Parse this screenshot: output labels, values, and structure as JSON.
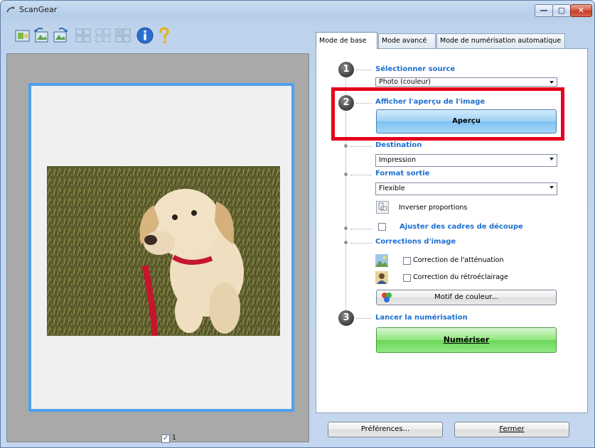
{
  "window": {
    "title": "ScanGear",
    "controls": {
      "minimize": "—",
      "maximize": "▢",
      "close": "✕"
    }
  },
  "toolbar": {
    "icons": [
      "scan-thumbnail-icon",
      "rotate-left-icon",
      "rotate-right-icon",
      "crop-icon",
      "select-all-icon",
      "remove-crop-icon",
      "info-icon",
      "help-icon"
    ]
  },
  "preview": {
    "thumbnail_number": "1",
    "thumbnail_checked": true
  },
  "tabs": [
    {
      "label": "Mode de base",
      "active": true
    },
    {
      "label": "Mode avancé",
      "active": false
    },
    {
      "label": "Mode de numérisation automatique",
      "active": false
    }
  ],
  "steps": {
    "step1": {
      "number": "1",
      "label": "Sélectionner source",
      "source_value": "Photo (couleur)"
    },
    "step2": {
      "number": "2",
      "label": "Afficher l'aperçu de l'image",
      "preview_button": "Aperçu"
    },
    "destination": {
      "label": "Destination",
      "value": "Impression"
    },
    "output_format": {
      "label": "Format sortie",
      "value": "Flexible"
    },
    "invert_ratio": {
      "label": "Inverser proportions"
    },
    "adjust_crop": {
      "label": "Ajuster des cadres de découpe",
      "checked": false
    },
    "corrections": {
      "label": "Corrections d'image",
      "fading": {
        "label": "Correction de l'atténuation",
        "checked": false
      },
      "backlight": {
        "label": "Correction du rétroéclairage",
        "checked": false
      },
      "color_pattern_button": "Motif de couleur..."
    },
    "step3": {
      "number": "3",
      "label": "Lancer la numérisation",
      "scan_button": "Numériser"
    }
  },
  "footer": {
    "preferences_button": "Préférences...",
    "close_button": "Fermer"
  },
  "colors": {
    "accent_blue": "#1d6fcf",
    "highlight_red": "#e4001b",
    "preview_border": "#4ea0f0",
    "scan_green": "#6ad75a"
  }
}
